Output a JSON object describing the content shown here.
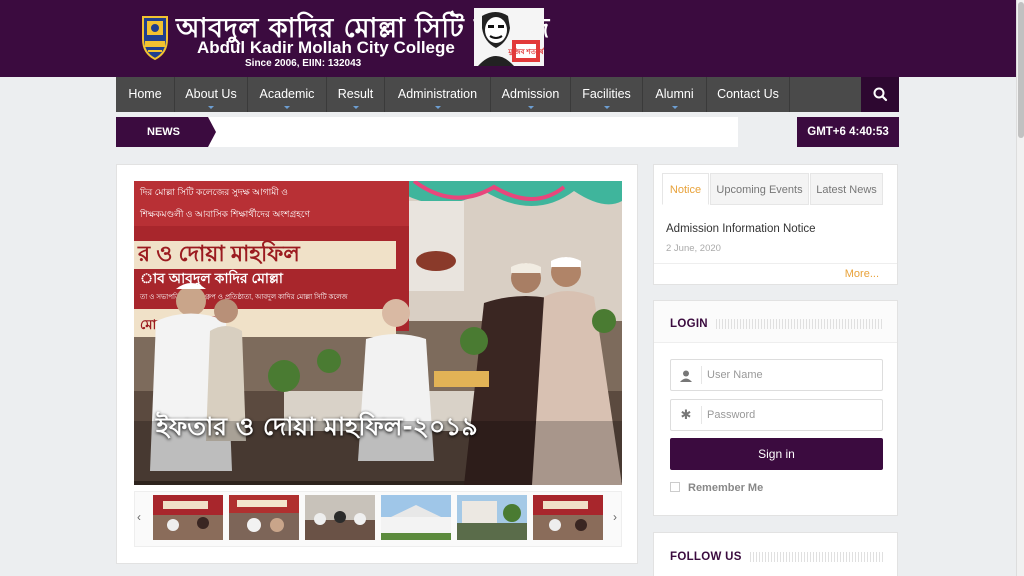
{
  "header": {
    "title_bn": "আবদুল কাদির মোল্লা সিটি কলেজ",
    "title_en": "Abdul Kadir Mollah City College",
    "since": "Since 2006, EIIN: 132043",
    "portrait_text": "মুজিব শতবর্ষ"
  },
  "nav": {
    "items": [
      {
        "label": "Home"
      },
      {
        "label": "About Us"
      },
      {
        "label": "Academic"
      },
      {
        "label": "Result"
      },
      {
        "label": "Administration"
      },
      {
        "label": "Admission"
      },
      {
        "label": "Facilities"
      },
      {
        "label": "Alumni"
      },
      {
        "label": "Contact Us"
      }
    ],
    "search_icon": "search-icon"
  },
  "ticker": {
    "label": "NEWS",
    "text": ""
  },
  "clock": {
    "text": "GMT+6 4:40:53"
  },
  "slider": {
    "caption": "ইফতার ও দোয়া মাহফিল-২০১৯",
    "banner_line1": "দির মোল্লা সিটি কলেজের সুদক্ষ আগামী ও",
    "banner_line2": "শিক্ষকমণ্ডলী ও আবাসিক শিক্ষার্থীদের অংশগ্রহণে",
    "banner_main": "র ও দোয়া মাহফিল",
    "banner_sub": "াব আবদুল কাদির মোল্লা",
    "banner_sub2": "তা ও সভাপতি, থার্মেক্স গ্রুপ ও প্রতিষ্ঠাতা, আবদুল কাদির মোল্লা সিটি কলেজ",
    "banner_place": "মোল্লা, নরসিংদী",
    "prev_icon": "chevron-left-icon",
    "next_icon": "chevron-right-icon"
  },
  "notice": {
    "tabs": [
      "Notice",
      "Upcoming Events",
      "Latest News"
    ],
    "active_tab": "Notice",
    "items": [
      {
        "title": "Admission Information Notice",
        "date": "2 June, 2020"
      }
    ],
    "more": "More..."
  },
  "login": {
    "title": "LOGIN",
    "username_placeholder": "User Name",
    "password_placeholder": "Password",
    "signin": "Sign in",
    "remember": "Remember Me"
  },
  "follow": {
    "title": "FOLLOW US"
  },
  "colors": {
    "brand": "#3b0b3f",
    "accent": "#e8a23a",
    "nav": "#4a4a4a"
  }
}
